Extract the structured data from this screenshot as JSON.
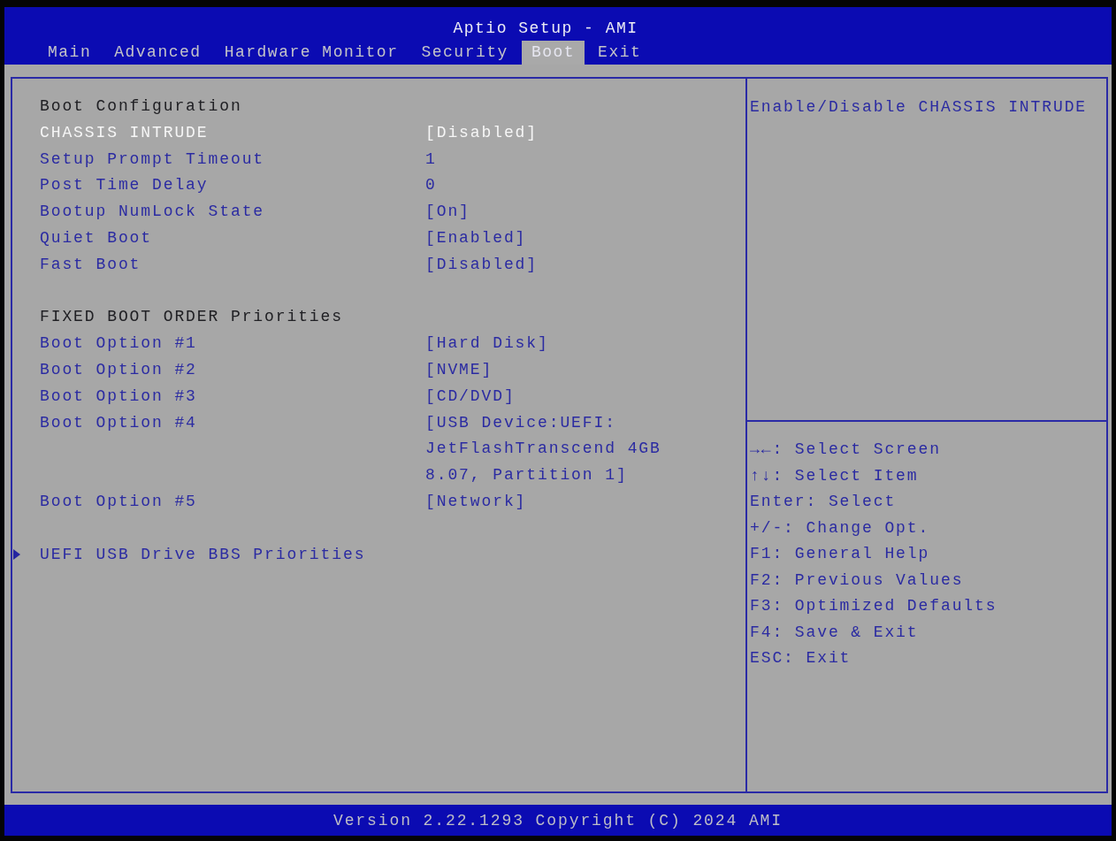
{
  "window": {
    "title": "Aptio Setup - AMI"
  },
  "tabs": [
    {
      "label": "Main",
      "selected": false
    },
    {
      "label": "Advanced",
      "selected": false
    },
    {
      "label": "Hardware Monitor",
      "selected": false
    },
    {
      "label": "Security",
      "selected": false
    },
    {
      "label": "Boot",
      "selected": true
    },
    {
      "label": "Exit",
      "selected": false
    }
  ],
  "sections": [
    {
      "heading": "Boot Configuration",
      "items": [
        {
          "label": "CHASSIS INTRUDE",
          "value": "[Disabled]",
          "selected": true
        },
        {
          "label": "Setup Prompt Timeout",
          "value": "1",
          "selected": false
        },
        {
          "label": "Post Time Delay",
          "value": "0",
          "selected": false
        },
        {
          "label": "Bootup NumLock State",
          "value": "[On]",
          "selected": false
        },
        {
          "label": "Quiet Boot",
          "value": "[Enabled]",
          "selected": false
        },
        {
          "label": "Fast Boot",
          "value": "[Disabled]",
          "selected": false
        }
      ]
    },
    {
      "heading": "FIXED BOOT ORDER Priorities",
      "items": [
        {
          "label": "Boot Option #1",
          "value": "[Hard Disk]",
          "selected": false
        },
        {
          "label": "Boot Option #2",
          "value": "[NVME]",
          "selected": false
        },
        {
          "label": "Boot Option #3",
          "value": "[CD/DVD]",
          "selected": false
        },
        {
          "label": "Boot Option #4",
          "value": "[USB Device:UEFI: JetFlashTranscend 4GB 8.07, Partition 1]",
          "selected": false
        },
        {
          "label": "Boot Option #5",
          "value": "[Network]",
          "selected": false
        }
      ]
    }
  ],
  "submenus": [
    {
      "label": "UEFI USB Drive BBS Priorities",
      "selected": false
    }
  ],
  "help": {
    "text": "Enable/Disable CHASSIS INTRUDE"
  },
  "key_legend": [
    "→←: Select Screen",
    "↑↓: Select Item",
    "Enter: Select",
    "+/-: Change Opt.",
    "F1: General Help",
    "F2: Previous Values",
    "F3: Optimized Defaults",
    "F4: Save & Exit",
    "ESC: Exit"
  ],
  "status_bar": {
    "text": "Version 2.22.1293 Copyright (C) 2024 AMI"
  }
}
